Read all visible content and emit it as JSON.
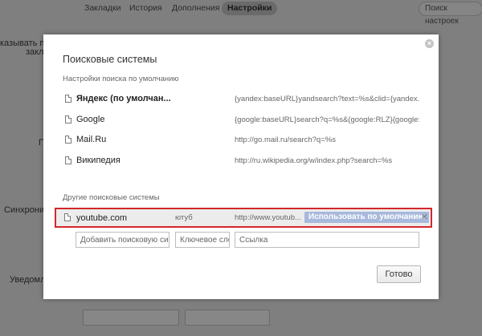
{
  "background": {
    "nav": {
      "tabs": [
        "Закладки",
        "История",
        "Дополнения",
        "Настройки"
      ],
      "search_placeholder": "Поиск настроек"
    },
    "labels": {
      "l1": "казывать па",
      "l2": "закл",
      "l3": "П",
      "l4": "Синхрониз",
      "l5": "Уведомл"
    }
  },
  "dialog": {
    "title": "Поисковые системы",
    "default_section_label": "Настройки поиска по умолчанию",
    "default_engines": [
      {
        "name": "Яндекс (по умолчан...",
        "url": "{yandex:baseURL}yandsearch?text=%s&clid={yandex..."
      },
      {
        "name": "Google",
        "url": "{google:baseURL}search?q=%s&{google:RLZ}{google:..."
      },
      {
        "name": "Mail.Ru",
        "url": "http://go.mail.ru/search?q=%s"
      },
      {
        "name": "Википедия",
        "url": "http://ru.wikipedia.org/w/index.php?search=%s"
      }
    ],
    "other_section_label": "Другие поисковые системы",
    "other_engine": {
      "name": "youtube.com",
      "keyword": "ютуб",
      "url": "http://www.youtub...",
      "make_default_label": "Использовать по умолчанию",
      "remove_label": "✕"
    },
    "add_fields": {
      "name_placeholder": "Добавить поисковую сис",
      "keyword_placeholder": "Ключевое сло",
      "url_placeholder": "Ссылка"
    },
    "close_label": "×",
    "done_label": "Готово"
  },
  "colors": {
    "highlight_border": "#d3272a",
    "default_button": "#a8b9dc"
  }
}
